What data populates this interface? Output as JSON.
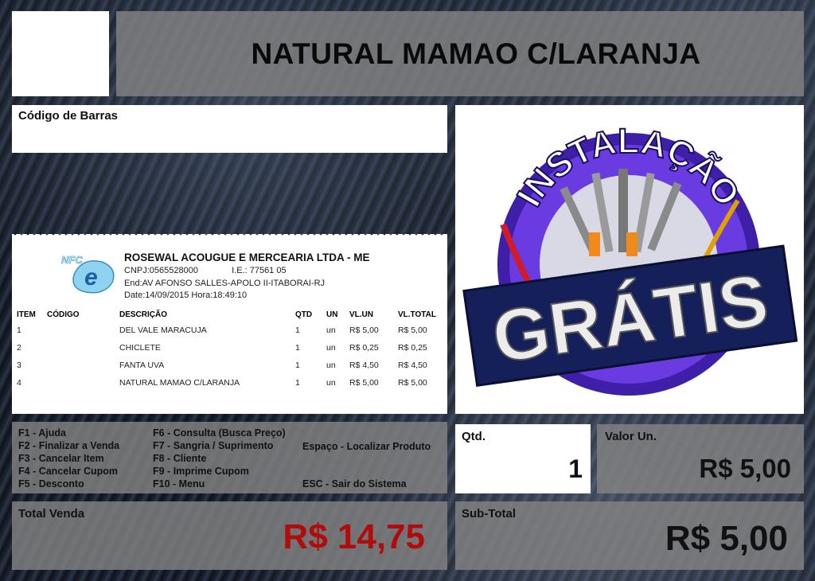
{
  "header": {
    "product_title": "NATURAL MAMAO C/LARANJA"
  },
  "barcode": {
    "label": "Código de Barras"
  },
  "promo": {
    "arc_text": "INSTALAÇÃO",
    "banner_text": "GRÁTIS"
  },
  "receipt": {
    "logo_text": "NFC",
    "logo_letter": "e",
    "company": "ROSEWAL ACOUGUE E MERCEARIA LTDA - ME",
    "cnpj": "CNPJ:0565528000",
    "ie": "I.E.: 77561",
    "ie_suffix": "05",
    "address": "End:AV AFONSO SALLES-APOLO II-ITABORAI-RJ",
    "datetime": "Date:14/09/2015 Hora:18:49:10",
    "columns": [
      "ITEM",
      "CÓDIGO",
      "DESCRIÇÃO",
      "QTD",
      "UN",
      "VL.UN",
      "VL.TOTAL"
    ],
    "items": [
      {
        "item": "1",
        "codigo": "",
        "descricao": "DEL VALE MARACUJA",
        "qtd": "1",
        "un": "un",
        "vlun": "R$ 5,00",
        "vltotal": "R$ 5,00"
      },
      {
        "item": "2",
        "codigo": "",
        "descricao": "CHICLETE",
        "qtd": "1",
        "un": "un",
        "vlun": "R$ 0,25",
        "vltotal": "R$ 0,25"
      },
      {
        "item": "3",
        "codigo": "",
        "descricao": "FANTA UVA",
        "qtd": "1",
        "un": "un",
        "vlun": "R$ 4,50",
        "vltotal": "R$ 4,50"
      },
      {
        "item": "4",
        "codigo": "",
        "descricao": "NATURAL MAMAO C/LARANJA",
        "qtd": "1",
        "un": "un",
        "vlun": "R$ 5,00",
        "vltotal": "R$ 5,00"
      }
    ]
  },
  "shortcuts": {
    "col1": [
      "F1 - Ajuda",
      "F2 - Finalizar a Venda",
      "F3 - Cancelar Item",
      "F4 - Cancelar Cupom",
      "F5 - Desconto"
    ],
    "col2": [
      "F6 - Consulta (Busca Preço)",
      "F7 - Sangria / Suprimento",
      "F8 - Cliente",
      "F9 - Imprime Cupom",
      "F10 - Menu"
    ],
    "space": "Espaço - Localizar Produto",
    "esc": "ESC - Sair do Sistema"
  },
  "quantity": {
    "label": "Qtd.",
    "value": "1"
  },
  "unit_price": {
    "label": "Valor Un.",
    "value": "R$ 5,00"
  },
  "total": {
    "label": "Total Venda",
    "value": "R$ 14,75"
  },
  "subtotal": {
    "label": "Sub-Total",
    "value": "R$ 5,00"
  },
  "colors": {
    "total_value": "#b10c0c",
    "panel_gray": "#828282",
    "banner_navy": "#15205a",
    "circle_purple": "#5a2bd0"
  }
}
